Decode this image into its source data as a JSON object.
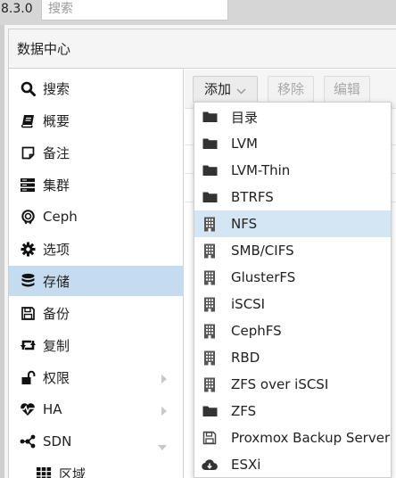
{
  "topbar": {
    "version": "8.3.0",
    "search_placeholder": "搜索"
  },
  "panel": {
    "title": "数据中心"
  },
  "toolbar": {
    "add_label": "添加",
    "remove_label": "移除",
    "edit_label": "编辑"
  },
  "nav": {
    "items": [
      {
        "label": "搜索",
        "icon": "search-icon"
      },
      {
        "label": "概要",
        "icon": "book-icon"
      },
      {
        "label": "备注",
        "icon": "note-icon"
      },
      {
        "label": "集群",
        "icon": "server-icon"
      },
      {
        "label": "Ceph",
        "icon": "ceph-icon"
      },
      {
        "label": "选项",
        "icon": "gear-icon"
      },
      {
        "label": "存储",
        "icon": "database-icon"
      },
      {
        "label": "备份",
        "icon": "save-icon"
      },
      {
        "label": "复制",
        "icon": "retweet-icon"
      },
      {
        "label": "权限",
        "icon": "unlock-icon"
      },
      {
        "label": "HA",
        "icon": "heartbeat-icon"
      },
      {
        "label": "SDN",
        "icon": "sdn-icon"
      },
      {
        "label": "区域",
        "icon": "grid-icon"
      }
    ]
  },
  "menu": {
    "items": [
      {
        "label": "目录",
        "icon": "folder-icon"
      },
      {
        "label": "LVM",
        "icon": "folder-icon"
      },
      {
        "label": "LVM-Thin",
        "icon": "folder-icon"
      },
      {
        "label": "BTRFS",
        "icon": "folder-icon"
      },
      {
        "label": "NFS",
        "icon": "building-icon"
      },
      {
        "label": "SMB/CIFS",
        "icon": "building-icon"
      },
      {
        "label": "GlusterFS",
        "icon": "building-icon"
      },
      {
        "label": "iSCSI",
        "icon": "building-icon"
      },
      {
        "label": "CephFS",
        "icon": "building-icon"
      },
      {
        "label": "RBD",
        "icon": "building-icon"
      },
      {
        "label": "ZFS over iSCSI",
        "icon": "building-icon"
      },
      {
        "label": "ZFS",
        "icon": "folder-icon"
      },
      {
        "label": "Proxmox Backup Server",
        "icon": "floppy-icon"
      },
      {
        "label": "ESXi",
        "icon": "cloud-download-icon"
      }
    ]
  },
  "colors": {
    "selected_nav": "#c5dcef",
    "hover_menu": "#d4e6f4",
    "border": "#cfcfcf"
  }
}
